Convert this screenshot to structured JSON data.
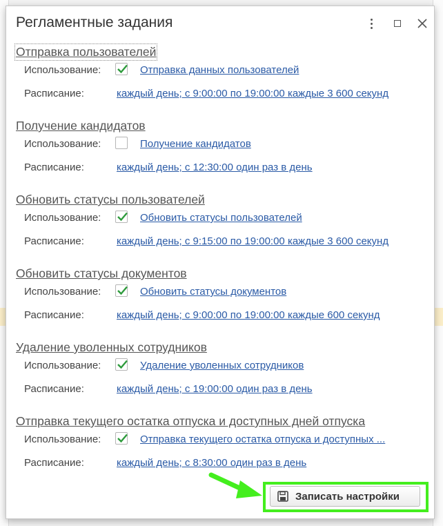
{
  "dialog": {
    "title": "Регламентные задания"
  },
  "labels": {
    "usage": "Использование:",
    "schedule": "Расписание:"
  },
  "sections": [
    {
      "title": "Отправка пользователей",
      "checked": true,
      "usage_link": "Отправка данных пользователей",
      "schedule": "каждый день; с 9:00:00 по 19:00:00 каждые 3 600 секунд"
    },
    {
      "title": "Получение кандидатов",
      "checked": false,
      "usage_link": "Получение кандидатов",
      "schedule": "каждый день; с 12:30:00 один раз в день"
    },
    {
      "title": "Обновить статусы пользователей",
      "checked": true,
      "usage_link": "Обновить статусы пользователей",
      "schedule": "каждый день; с 9:15:00 по 19:00:00 каждые 3 600 секунд"
    },
    {
      "title": "Обновить статусы документов",
      "checked": true,
      "usage_link": "Обновить статусы документов",
      "schedule": "каждый день; с 9:00:00 по 19:00:00 каждые 600 секунд"
    },
    {
      "title": "Удаление уволенных сотрудников",
      "checked": true,
      "usage_link": "Удаление уволенных сотрудников",
      "schedule": "каждый день; с 19:00:00 один раз в день"
    },
    {
      "title": "Отправка текущего остатка отпуска и доступных дней отпуска",
      "checked": true,
      "usage_link": "Отправка текущего остатка отпуска и доступных ...",
      "schedule": "каждый день; с 8:30:00 один раз в день"
    }
  ],
  "footer": {
    "save_label": "Записать настройки"
  },
  "colors": {
    "link": "#2a5aa6",
    "check": "#2e9b3c",
    "highlight": "#44ee1e"
  }
}
